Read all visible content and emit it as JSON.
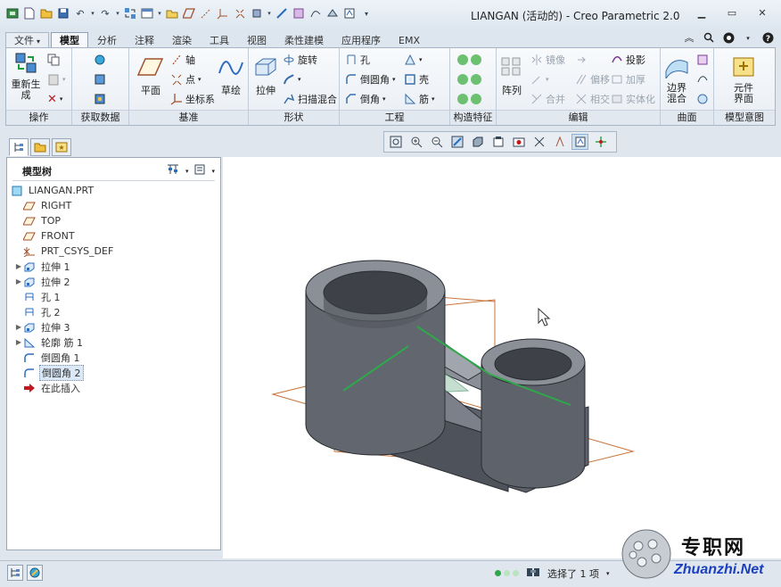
{
  "window": {
    "title": "LIANGAN (活动的) - Creo Parametric 2.0"
  },
  "tabs": [
    {
      "label": "文件",
      "kind": "file"
    },
    {
      "label": "模型",
      "kind": "active"
    },
    {
      "label": "分析"
    },
    {
      "label": "注释"
    },
    {
      "label": "渲染"
    },
    {
      "label": "工具"
    },
    {
      "label": "视图"
    },
    {
      "label": "柔性建模"
    },
    {
      "label": "应用程序"
    },
    {
      "label": "EMX"
    }
  ],
  "file_arrow": "▾",
  "ribbon": {
    "groups": [
      "操作",
      "获取数据",
      "基准",
      "形状",
      "工程",
      "构造特征",
      "编辑",
      "曲面",
      "模型意图"
    ],
    "regenerate": "重新生成",
    "plane": "平面",
    "axis": "轴",
    "point": "点",
    "csys": "坐标系",
    "sketch": "草绘",
    "extrude": "拉伸",
    "revolve": "旋转",
    "sweep_blend": "扫描混合",
    "hole": "孔",
    "round": "倒圆角",
    "chamfer": "倒角",
    "shell": "壳",
    "rib": "筋",
    "pattern": "阵列",
    "mirror": "镜像",
    "offset": "偏移",
    "thicken": "加厚",
    "merge": "合并",
    "intersect": "相交",
    "solidify": "实体化",
    "project": "投影",
    "boundary_blend": "边界混合",
    "component_interface": "元件界面"
  },
  "model_tree": {
    "title": "模型树",
    "items": [
      {
        "label": "LIANGAN.PRT",
        "icon": "part-icon",
        "expandable": false
      },
      {
        "label": "RIGHT",
        "icon": "datum-plane-icon",
        "expandable": false
      },
      {
        "label": "TOP",
        "icon": "datum-plane-icon",
        "expandable": false
      },
      {
        "label": "FRONT",
        "icon": "datum-plane-icon",
        "expandable": false
      },
      {
        "label": "PRT_CSYS_DEF",
        "icon": "csys-icon",
        "expandable": false
      },
      {
        "label": "拉伸 1",
        "icon": "extrude-icon",
        "expandable": true
      },
      {
        "label": "拉伸 2",
        "icon": "extrude-icon",
        "expandable": true
      },
      {
        "label": "孔 1",
        "icon": "hole-icon",
        "expandable": false
      },
      {
        "label": "孔 2",
        "icon": "hole-icon",
        "expandable": false
      },
      {
        "label": "拉伸 3",
        "icon": "extrude-icon",
        "expandable": true
      },
      {
        "label": "轮廓 筋 1",
        "icon": "rib-icon",
        "expandable": true
      },
      {
        "label": "倒圆角 1",
        "icon": "round-icon",
        "expandable": false
      },
      {
        "label": "倒圆角 2",
        "icon": "round-icon",
        "expandable": false,
        "selected": true
      },
      {
        "label": "在此插入",
        "icon": "insert-here-icon",
        "expandable": false
      }
    ]
  },
  "status": {
    "selection": "选择了 1 项"
  },
  "watermark": {
    "cn": "专职网",
    "en": "Zhuanzhi.Net"
  },
  "colors": {
    "accent": "#2f6fb6",
    "model_gray": "#6b6f78",
    "edge_green": "#2ea84a",
    "datum_orange": "#c8743a",
    "insert_red": "#c0181c"
  }
}
